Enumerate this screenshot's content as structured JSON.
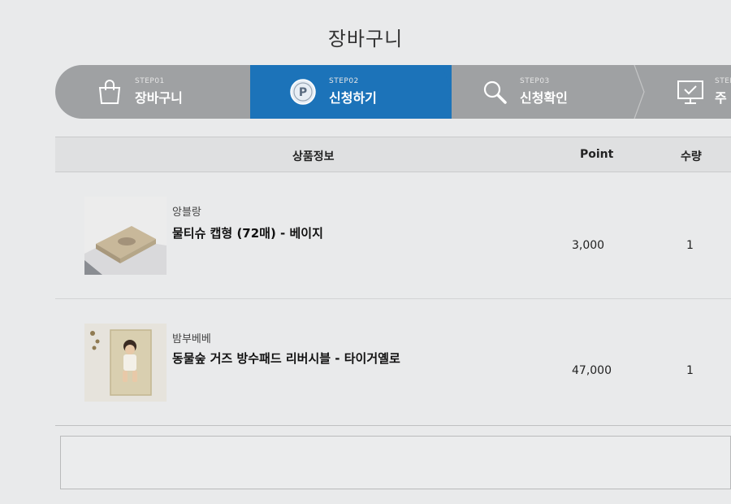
{
  "page": {
    "title": "장바구니"
  },
  "steps": [
    {
      "num": "STEP01",
      "label": "장바구니",
      "icon": "shopping-bag-icon",
      "active": false
    },
    {
      "num": "STEP02",
      "label": "신청하기",
      "icon": "point-coin-icon",
      "active": true
    },
    {
      "num": "STEP03",
      "label": "신청확인",
      "icon": "magnifier-icon",
      "active": false
    },
    {
      "num": "STEP",
      "label": "주",
      "icon": "monitor-check-icon",
      "active": false
    }
  ],
  "table": {
    "headers": {
      "info": "상품정보",
      "point": "Point",
      "qty": "수량"
    },
    "rows": [
      {
        "brand": "앙블랑",
        "name": "물티슈 캡형 (72매) - 베이지",
        "point": "3,000",
        "qty": "1"
      },
      {
        "brand": "밤부베베",
        "name": "동물숲 거즈 방수패드 리버시블 - 타이거옐로",
        "point": "47,000",
        "qty": "1"
      }
    ]
  },
  "colors": {
    "active_step": "#1c73b9",
    "step_bar": "#9fa1a3",
    "background": "#e9eaeb"
  }
}
